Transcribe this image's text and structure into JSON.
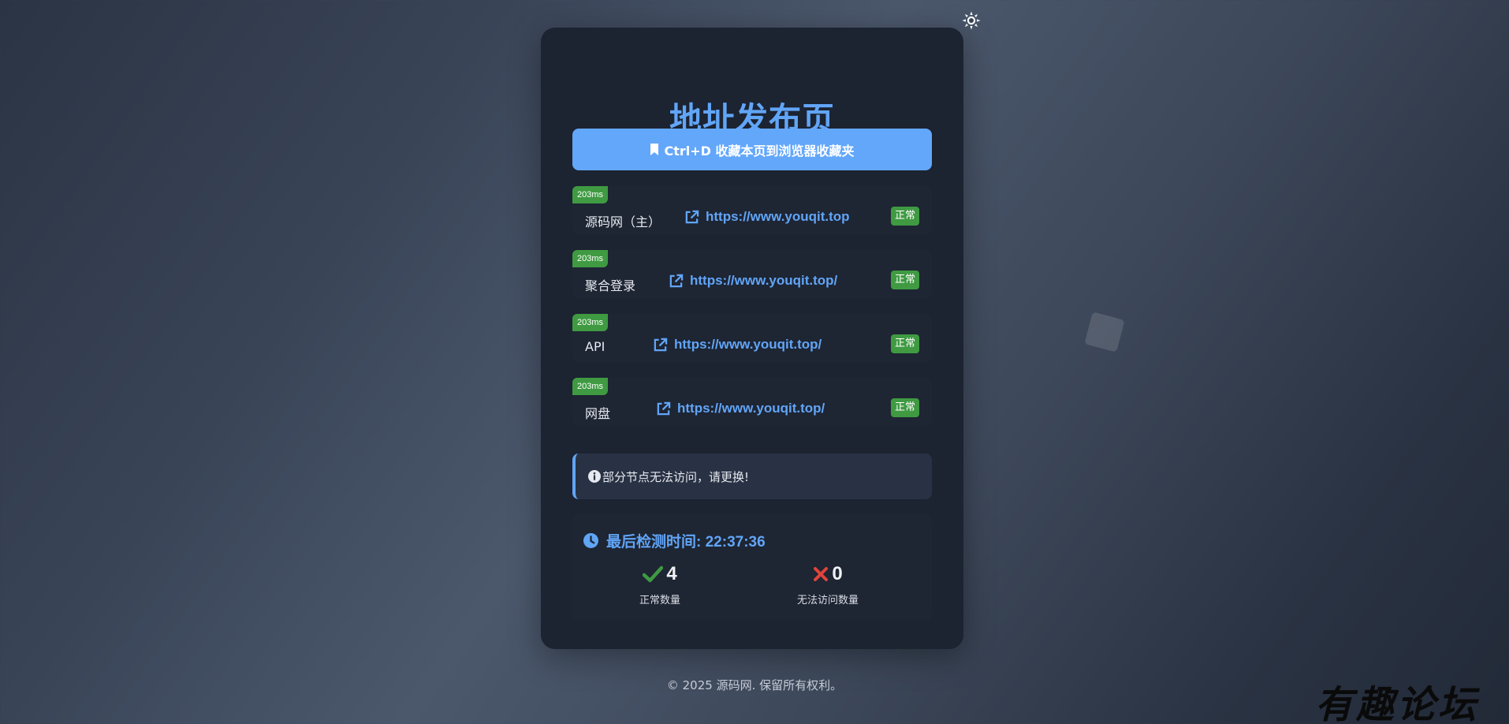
{
  "header": {
    "title": "地址发布页"
  },
  "bookmark": {
    "label": "Ctrl+D 收藏本页到浏览器收藏夹"
  },
  "links": [
    {
      "latency": "203ms",
      "name": "源码网（主）",
      "url": "https://www.youqit.top",
      "status": "正常"
    },
    {
      "latency": "203ms",
      "name": "聚合登录",
      "url": "https://www.youqit.top/",
      "status": "正常"
    },
    {
      "latency": "203ms",
      "name": "API",
      "url": "https://www.youqit.top/",
      "status": "正常"
    },
    {
      "latency": "203ms",
      "name": "网盘",
      "url": "https://www.youqit.top/",
      "status": "正常"
    }
  ],
  "notice": {
    "text": "部分节点无法访问，请更换!"
  },
  "stats": {
    "check_time_label": "最后检测时间: 22:37:36",
    "ok_count": "4",
    "ok_label": "正常数量",
    "fail_count": "0",
    "fail_label": "无法访问数量"
  },
  "footer": {
    "text": "© 2025 源码网. 保留所有权利。"
  },
  "watermark": {
    "text": "有趣论坛"
  },
  "icons": {
    "theme": "sun-icon",
    "bookmark": "bookmark-icon",
    "link": "external-link-icon",
    "notice": "info-icon",
    "clock": "clock-icon",
    "ok": "check-icon",
    "fail": "x-icon"
  },
  "colors": {
    "accent": "#61a5f7",
    "success": "#3f9a42",
    "danger": "#e0443a",
    "card": "#1c2331"
  }
}
